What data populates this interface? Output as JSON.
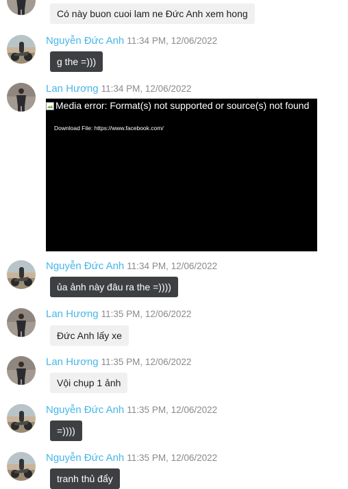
{
  "messages": [
    {
      "avatar": "lan-avatar",
      "text": "Có này buon cuoi lam ne Đức Anh xem hong",
      "style": "light"
    },
    {
      "sender": "Nguyễn Đức Anh",
      "time": "11:34 PM, 12/06/2022",
      "avatar": "duc-anh-avatar",
      "text": "g the =)))",
      "style": "dark"
    },
    {
      "sender": "Lan Hương",
      "time": "11:34 PM, 12/06/2022",
      "avatar": "lan-avatar",
      "media": {
        "error_text": "Media error: Format(s) not supported or source(s) not found",
        "download_text": "Download File: https://www.facebook.com/"
      }
    },
    {
      "sender": "Nguyễn Đức Anh",
      "time": "11:34 PM, 12/06/2022",
      "avatar": "duc-anh-avatar",
      "text": "ủa ảnh này đâu ra the =))))",
      "style": "dark"
    },
    {
      "sender": "Lan Hương",
      "time": "11:35 PM, 12/06/2022",
      "avatar": "lan-avatar",
      "text": "Đức Anh lấy xe",
      "style": "light"
    },
    {
      "sender": "Lan Hương",
      "time": "11:35 PM, 12/06/2022",
      "avatar": "lan-avatar",
      "text": "Vội chụp 1 ảnh",
      "style": "light"
    },
    {
      "sender": "Nguyễn Đức Anh",
      "time": "11:35 PM, 12/06/2022",
      "avatar": "duc-anh-avatar",
      "text": "=))))",
      "style": "dark"
    },
    {
      "sender": "Nguyễn Đức Anh",
      "time": "11:35 PM, 12/06/2022",
      "avatar": "duc-anh-avatar",
      "text": "tranh thủ đẩy",
      "style": "dark"
    }
  ],
  "colors": {
    "sender_name": "#45b6e8",
    "timestamp": "#8a8a8a",
    "light_bubble": "#f0f0f0",
    "dark_bubble": "#3d3f42",
    "media_background": "#000000"
  }
}
